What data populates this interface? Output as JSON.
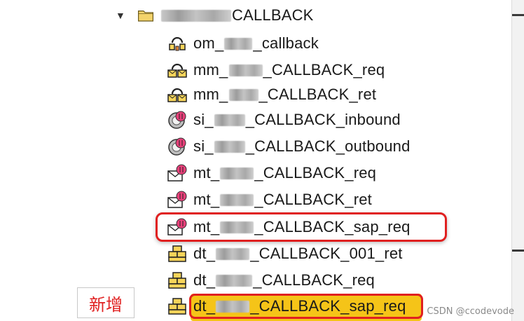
{
  "tree": {
    "folder": {
      "label_suffix": "CALLBACK"
    },
    "items": [
      {
        "icon": "operation-mapping-icon",
        "prefix": "om_",
        "suffix": "_callback"
      },
      {
        "icon": "message-mapping-icon",
        "prefix": "mm_",
        "suffix": "_CALLBACK_req"
      },
      {
        "icon": "message-mapping-icon",
        "prefix": "mm_",
        "suffix": "_CALLBACK_ret"
      },
      {
        "icon": "service-interface-icon",
        "prefix": "si_",
        "suffix": "_CALLBACK_inbound"
      },
      {
        "icon": "service-interface-icon",
        "prefix": "si_",
        "suffix": "_CALLBACK_outbound"
      },
      {
        "icon": "message-type-icon",
        "prefix": "mt_",
        "suffix": "_CALLBACK_req"
      },
      {
        "icon": "message-type-icon",
        "prefix": "mt_",
        "suffix": "_CALLBACK_ret"
      },
      {
        "icon": "message-type-icon",
        "prefix": "mt_",
        "suffix": "_CALLBACK_sap_req"
      },
      {
        "icon": "data-type-icon",
        "prefix": "dt_",
        "suffix": "_CALLBACK_001_ret"
      },
      {
        "icon": "data-type-icon",
        "prefix": "dt_",
        "suffix": "_CALLBACK_req"
      },
      {
        "icon": "data-type-icon",
        "prefix": "dt_",
        "suffix": "_CALLBACK_sap_req"
      }
    ]
  },
  "annotation": {
    "new_label": "新增"
  },
  "watermark": "CSDN @ccodevode",
  "colors": {
    "highlight_red": "#e02020",
    "highlight_yellow": "#f5c418"
  }
}
